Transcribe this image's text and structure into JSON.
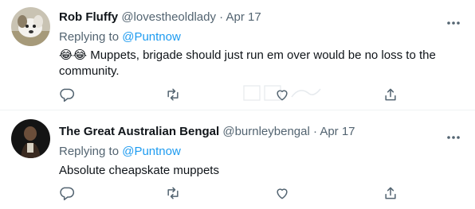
{
  "tweets": [
    {
      "name": "Rob Fluffy",
      "handle": "@lovestheoldlady",
      "separator": "·",
      "date": "Apr 17",
      "replying_prefix": "Replying to ",
      "replying_handle": "@Puntnow",
      "text": "😂😂 Muppets, brigade should just run em over would be no loss to the community.",
      "avatar_icon": "dog-avatar"
    },
    {
      "name": "The Great Australian Bengal",
      "handle": "@burnleybengal",
      "separator": "·",
      "date": "Apr 17",
      "replying_prefix": "Replying to ",
      "replying_handle": "@Puntnow",
      "text": "Absolute cheapskate muppets",
      "avatar_icon": "person-avatar"
    }
  ],
  "colors": {
    "text": "#0f1419",
    "secondary": "#536471",
    "link": "#1d9bf0",
    "divider": "#eff3f4"
  }
}
